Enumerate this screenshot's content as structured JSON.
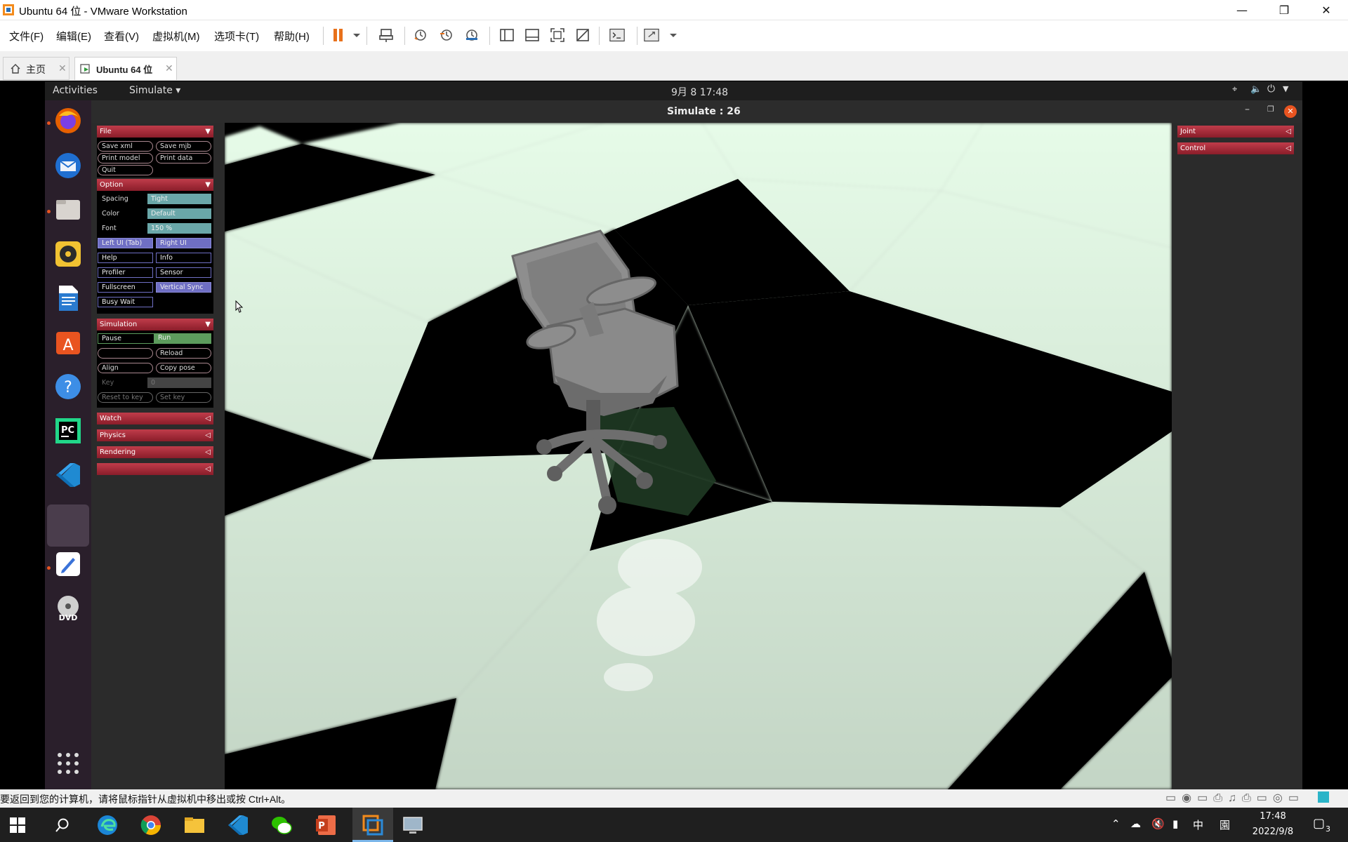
{
  "window": {
    "title": "Ubuntu 64 位 - VMware Workstation"
  },
  "menubar": {
    "items": [
      "文件(F)",
      "编辑(E)",
      "查看(V)",
      "虚拟机(M)",
      "选项卡(T)",
      "帮助(H)"
    ]
  },
  "tabs": [
    {
      "label": "主页"
    },
    {
      "label": "Ubuntu 64 位"
    }
  ],
  "gnome": {
    "activities": "Activities",
    "app_menu": "Simulate",
    "clock": "9月 8  17:48"
  },
  "app": {
    "title": "Simulate : 26"
  },
  "left_ui": {
    "file": {
      "title": "File",
      "buttons": [
        "Save xml",
        "Save mjb",
        "Print model",
        "Print data",
        "Quit"
      ]
    },
    "option": {
      "title": "Option",
      "spacing": {
        "label": "Spacing",
        "value": "Tight"
      },
      "color": {
        "label": "Color",
        "value": "Default"
      },
      "font": {
        "label": "Font",
        "value": "150 %"
      },
      "toggles": [
        "Left UI (Tab)",
        "Right UI",
        "Help",
        "Info",
        "Profiler",
        "Sensor",
        "Fullscreen",
        "Vertical Sync",
        "Busy Wait"
      ]
    },
    "simulation": {
      "title": "Simulation",
      "pause": "Pause",
      "run": "Run",
      "reload": "Reload",
      "align": "Align",
      "copy_pose": "Copy pose",
      "key_label": "Key",
      "key_value": "0",
      "reset_to_key": "Reset to key",
      "set_key": "Set key"
    },
    "collapsed": [
      "Watch",
      "Physics",
      "Rendering",
      ""
    ]
  },
  "right_ui": {
    "sections": [
      "Joint",
      "Control"
    ]
  },
  "statusbar": {
    "text": "要返回到您的计算机，请将鼠标指针从虚拟机中移出或按 Ctrl+Alt。"
  },
  "taskbar": {
    "time": "17:48",
    "date": "2022/9/8",
    "ime": "中",
    "notifications": "3"
  },
  "colors": {
    "accent": "#e95420",
    "section": "#b02a3a",
    "value_teal": "#6aa7a9",
    "toggle_on": "#6f6fc4",
    "run_green": "#5d9c5d",
    "tile_light": "#e6fbe8"
  }
}
